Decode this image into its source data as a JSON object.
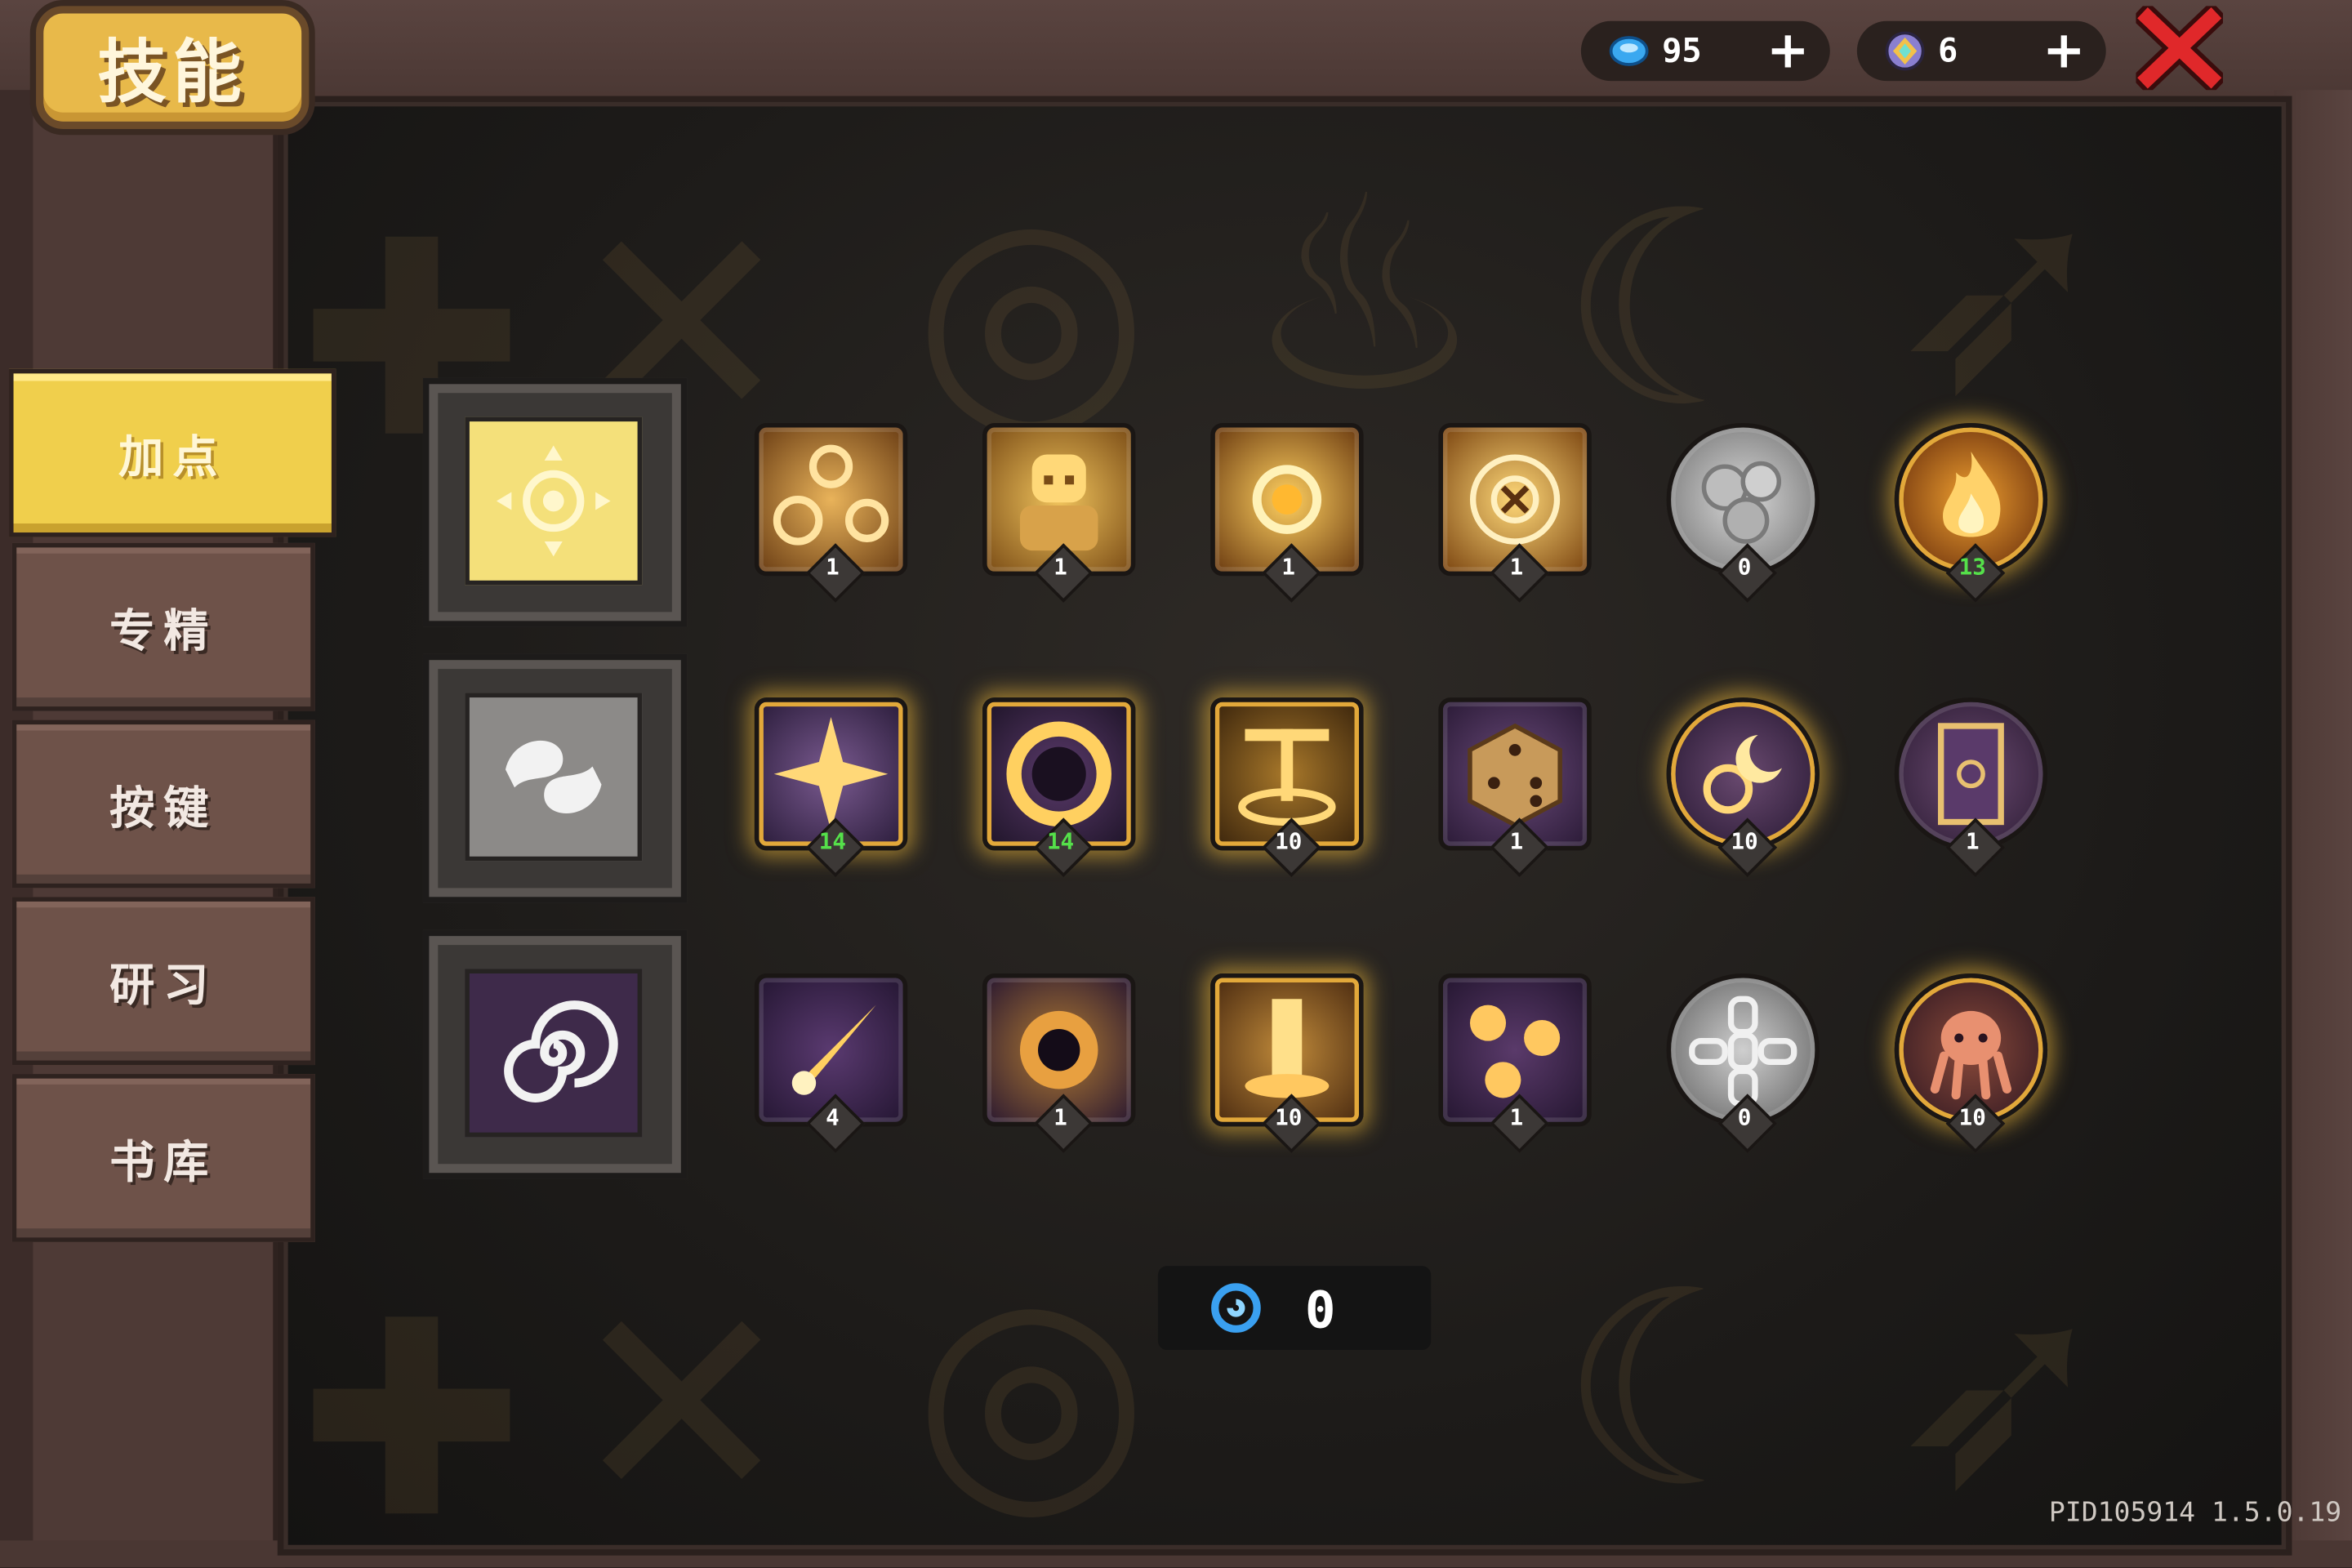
{
  "header": {
    "title": "技能"
  },
  "currency": {
    "gems": {
      "icon": "blue-gem-icon",
      "value": "95"
    },
    "crystals": {
      "icon": "rainbow-crystal-icon",
      "value": "6"
    }
  },
  "tabs": [
    {
      "label": "加点",
      "active": true
    },
    {
      "label": "专精",
      "active": false
    },
    {
      "label": "按键",
      "active": false
    },
    {
      "label": "研习",
      "active": false
    },
    {
      "label": "书库",
      "active": false
    }
  ],
  "categories": [
    {
      "icon": "sun-icon",
      "selected": true
    },
    {
      "icon": "yin-yang-icon",
      "selected": false
    },
    {
      "icon": "spiral-icon",
      "selected": false
    }
  ],
  "skill_rows": [
    [
      {
        "icon": "orbs-icon",
        "level": "1",
        "shape": "square",
        "glow": false
      },
      {
        "icon": "golem-icon",
        "level": "1",
        "shape": "square",
        "glow": false
      },
      {
        "icon": "sunburst-icon",
        "level": "1",
        "shape": "square",
        "glow": false
      },
      {
        "icon": "radiant-rune-icon",
        "level": "1",
        "shape": "square",
        "glow": false
      },
      {
        "icon": "stone-cluster-icon",
        "level": "0",
        "shape": "round",
        "glow": false
      },
      {
        "icon": "flame-icon",
        "level": "13",
        "shape": "round",
        "glow": true
      }
    ],
    [
      {
        "icon": "star-burst-icon",
        "level": "14",
        "shape": "square",
        "glow": true
      },
      {
        "icon": "eclipse-ring-icon",
        "level": "14",
        "shape": "square",
        "glow": true
      },
      {
        "icon": "altar-icon",
        "level": "10",
        "shape": "square",
        "glow": true
      },
      {
        "icon": "dice-icon",
        "level": "1",
        "shape": "square",
        "glow": false
      },
      {
        "icon": "moon-sigil-icon",
        "level": "10",
        "shape": "round",
        "glow": true
      },
      {
        "icon": "tarot-card-icon",
        "level": "1",
        "shape": "round",
        "glow": false
      }
    ],
    [
      {
        "icon": "comet-icon",
        "level": "4",
        "shape": "square",
        "glow": false
      },
      {
        "icon": "black-hole-icon",
        "level": "1",
        "shape": "square",
        "glow": false
      },
      {
        "icon": "light-pillar-icon",
        "level": "10",
        "shape": "square",
        "glow": true
      },
      {
        "icon": "triple-orb-icon",
        "level": "1",
        "shape": "square",
        "glow": false
      },
      {
        "icon": "chain-icon",
        "level": "0",
        "shape": "round",
        "glow": false
      },
      {
        "icon": "octopus-icon",
        "level": "10",
        "shape": "round",
        "glow": true
      }
    ]
  ],
  "skill_points": {
    "icon": "blue-swirl-icon",
    "value": "0"
  },
  "footer": {
    "version": "PID105914 1.5.0.19"
  },
  "colors": {
    "accent": "#f0cf4c",
    "level_green": "#55e04a",
    "close_red": "#e0282a"
  }
}
